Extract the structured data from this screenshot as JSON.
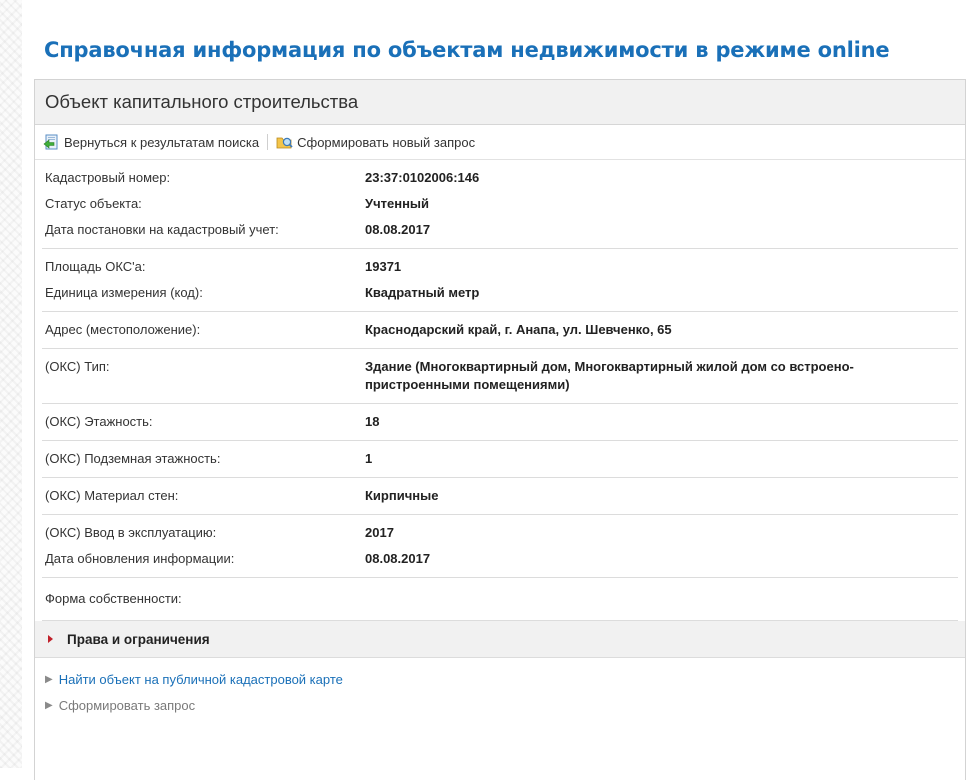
{
  "page": {
    "title": "Справочная информация по объектам недвижимости в режиме online"
  },
  "panel": {
    "title": "Объект капитального строительства",
    "toolbar": {
      "back_label": "Вернуться к результатам поиска",
      "new_query_label": "Сформировать новый запрос"
    },
    "fields": {
      "cadastral_number": {
        "label": "Кадастровый номер:",
        "value": "23:37:0102006:146"
      },
      "status": {
        "label": "Статус объекта:",
        "value": "Учтенный"
      },
      "registration_date": {
        "label": "Дата постановки на кадастровый учет:",
        "value": "08.08.2017"
      },
      "area": {
        "label": "Площадь ОКС'а:",
        "value": "19371"
      },
      "unit": {
        "label": "Единица измерения (код):",
        "value": "Квадратный метр"
      },
      "address": {
        "label": "Адрес (местоположение):",
        "value": "Краснодарский край, г. Анапа, ул. Шевченко, 65"
      },
      "type": {
        "label": "(ОКС) Тип:",
        "value": "Здание (Многоквартирный дом, Многоквартирный жилой дом со встроено-пристроенными помещениями)"
      },
      "floors": {
        "label": "(ОКС) Этажность:",
        "value": "18"
      },
      "underground_floors": {
        "label": "(ОКС) Подземная этажность:",
        "value": "1"
      },
      "wall_material": {
        "label": "(ОКС) Материал стен:",
        "value": "Кирпичные"
      },
      "commissioning": {
        "label": "(ОКС) Ввод в эксплуатацию:",
        "value": "2017"
      },
      "updated": {
        "label": "Дата обновления информации:",
        "value": "08.08.2017"
      },
      "ownership": {
        "label": "Форма собственности:",
        "value": ""
      }
    },
    "rights_section": "Права и ограничения",
    "links": {
      "find_on_map": "Найти объект на публичной кадастровой карте",
      "make_request": "Сформировать запрос"
    }
  },
  "colors": {
    "title_blue": "#1a70b8",
    "header_bg": "#f1f1f1",
    "accent_red": "#c0202a"
  },
  "icons": [
    "back-arrow-icon",
    "new-query-icon",
    "triangle-right-icon",
    "chevron-right-icon"
  ]
}
